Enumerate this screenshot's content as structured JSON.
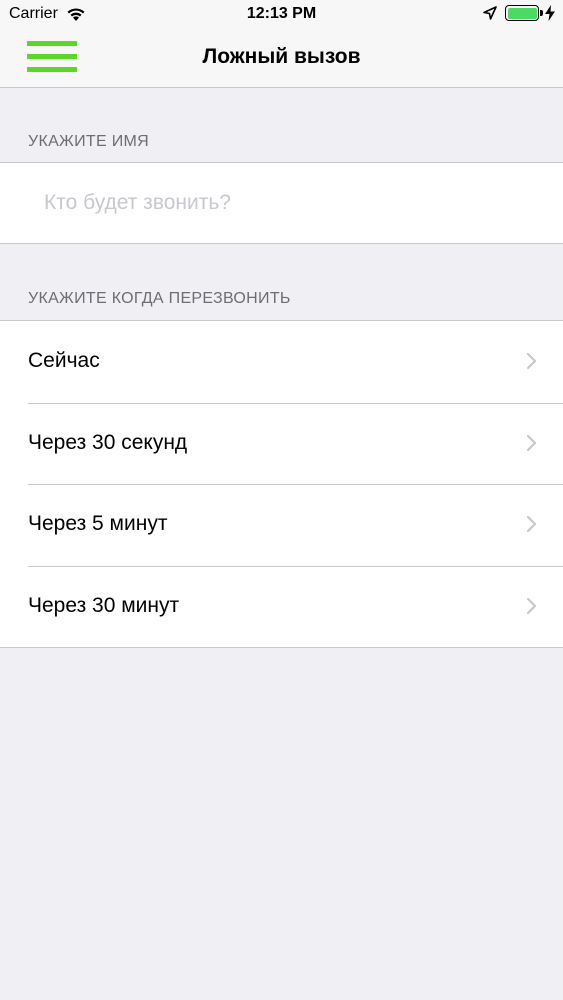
{
  "status_bar": {
    "carrier": "Carrier",
    "time": "12:13 PM",
    "icons": [
      "wifi-icon",
      "location-arrow-icon",
      "battery-icon",
      "charging-bolt-icon"
    ]
  },
  "nav_bar": {
    "title": "Ложный вызов",
    "menu_icon": "hamburger-menu-icon",
    "accent_color": "#5dd62c"
  },
  "name_section": {
    "header": "УКАЖИТЕ ИМЯ",
    "input_value": "",
    "input_placeholder": "Кто будет звонить?"
  },
  "callback_section": {
    "header": "УКАЖИТЕ КОГДА ПЕРЕЗВОНИТЬ",
    "options": [
      {
        "label": "Сейчас"
      },
      {
        "label": "Через 30 секунд"
      },
      {
        "label": "Через 5 минут"
      },
      {
        "label": "Через 30 минут"
      }
    ]
  },
  "colors": {
    "background": "#efeff4",
    "section_header": "#6d6d72",
    "placeholder": "#c7c7cd",
    "battery": "#4cd964"
  }
}
